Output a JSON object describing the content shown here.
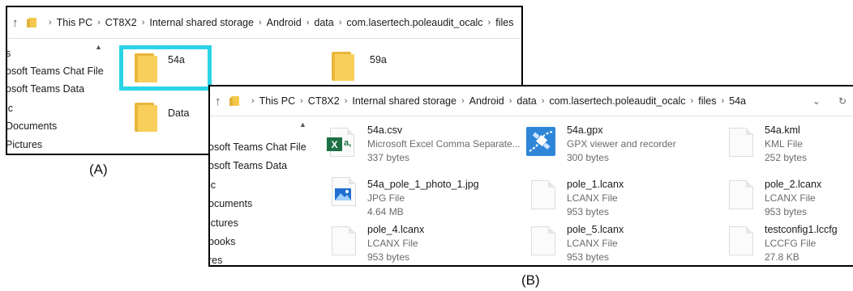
{
  "captions": {
    "a": "(A)",
    "b": "(B)"
  },
  "colors": {
    "selection": "#2ad4e6",
    "folder": "#f7cf5a",
    "excel": "#1d7044",
    "gpx": "#2f86d8"
  },
  "window_a": {
    "breadcrumb": [
      "This PC",
      "CT8X2",
      "Internal shared storage",
      "Android",
      "data",
      "com.lasertech.poleaudit_ocalc",
      "files"
    ],
    "nav": [
      "s",
      "osoft Teams Chat File",
      "osoft Teams Data",
      "ic",
      "Documents",
      "Pictures"
    ],
    "items": [
      {
        "name": "54a",
        "icon": "folder-icon",
        "selected": true
      },
      {
        "name": "59a",
        "icon": "folder-icon",
        "selected": false
      },
      {
        "name": "Data",
        "icon": "folder-icon",
        "selected": false
      }
    ]
  },
  "window_b": {
    "breadcrumb": [
      "This PC",
      "CT8X2",
      "Internal shared storage",
      "Android",
      "data",
      "com.lasertech.poleaudit_ocalc",
      "files",
      "54a"
    ],
    "nav": [
      "osoft Teams Chat File",
      "osoft Teams Data",
      "ic",
      "ocuments",
      "ictures",
      "books",
      "res"
    ],
    "files": [
      {
        "name": "54a.csv",
        "type": "Microsoft Excel Comma Separate...",
        "size": "337 bytes",
        "icon": "excel-icon"
      },
      {
        "name": "54a.gpx",
        "type": "GPX viewer and recorder",
        "size": "300 bytes",
        "icon": "gpx-viewer-icon"
      },
      {
        "name": "54a.kml",
        "type": "KML File",
        "size": "252 bytes",
        "icon": "document-icon"
      },
      {
        "name": "54a_pole_1_photo_1.jpg",
        "type": "JPG File",
        "size": "4.64 MB",
        "icon": "image-icon"
      },
      {
        "name": "pole_1.lcanx",
        "type": "LCANX File",
        "size": "953 bytes",
        "icon": "document-icon"
      },
      {
        "name": "pole_2.lcanx",
        "type": "LCANX File",
        "size": "953 bytes",
        "icon": "document-icon"
      },
      {
        "name": "pole_4.lcanx",
        "type": "LCANX File",
        "size": "953 bytes",
        "icon": "document-icon"
      },
      {
        "name": "pole_5.lcanx",
        "type": "LCANX File",
        "size": "953 bytes",
        "icon": "document-icon"
      },
      {
        "name": "testconfig1.lccfg",
        "type": "LCCFG File",
        "size": "27.8 KB",
        "icon": "document-icon"
      }
    ]
  }
}
